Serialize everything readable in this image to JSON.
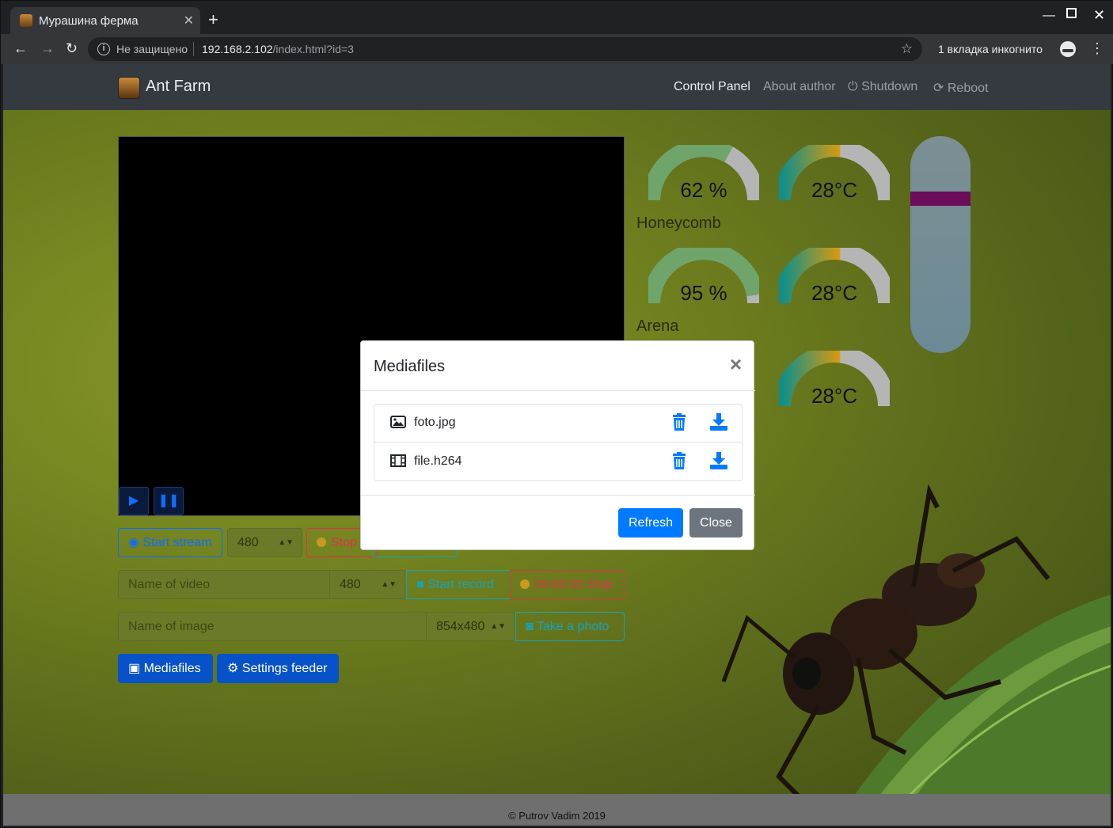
{
  "browser": {
    "tab_title": "Мурашина ферма",
    "not_secure": "Не защищено",
    "url_host": "192.168.2.102",
    "url_path": "/index.html?id=3",
    "incognito_label": "1 вкладка инкогнито"
  },
  "navbar": {
    "brand": "Ant Farm",
    "links": [
      "Control Panel",
      "About author",
      "Shutdown",
      "Reboot"
    ]
  },
  "controls": {
    "start_stream": "Start stream",
    "stream_res": "480",
    "stop": "Stop",
    "video_name_placeholder": "Name of video",
    "video_res": "480",
    "start_record": "Start record",
    "record_stop": "00:00:00 Stop",
    "image_name_placeholder": "Name of image",
    "image_res": "854x480",
    "take_photo": "Take a photo",
    "mediafiles": "Mediafiles",
    "settings_feeder": "Settings feeder"
  },
  "sensors": [
    {
      "name": "Honeycomb",
      "humidity": "62 %",
      "humidity_value": 62,
      "temp": "28°C",
      "temp_value": 28
    },
    {
      "name": "Arena",
      "humidity": "95 %",
      "humidity_value": 95,
      "temp": "28°C",
      "temp_value": 28
    },
    {
      "name": "",
      "temp": "28°C",
      "temp_value": 28
    }
  ],
  "modal": {
    "title": "Mediafiles",
    "files": [
      {
        "name": "foto.jpg",
        "type": "image"
      },
      {
        "name": "file.h264",
        "type": "video"
      }
    ],
    "refresh": "Refresh",
    "close": "Close"
  },
  "footer": "© Putrov Vadim 2019",
  "colors": {
    "primary": "#007bff",
    "secondary": "#6c757d",
    "navbar": "#343a40",
    "humidity_arc": "#6fa56a",
    "gauge_rest": "#b5b5b5"
  }
}
